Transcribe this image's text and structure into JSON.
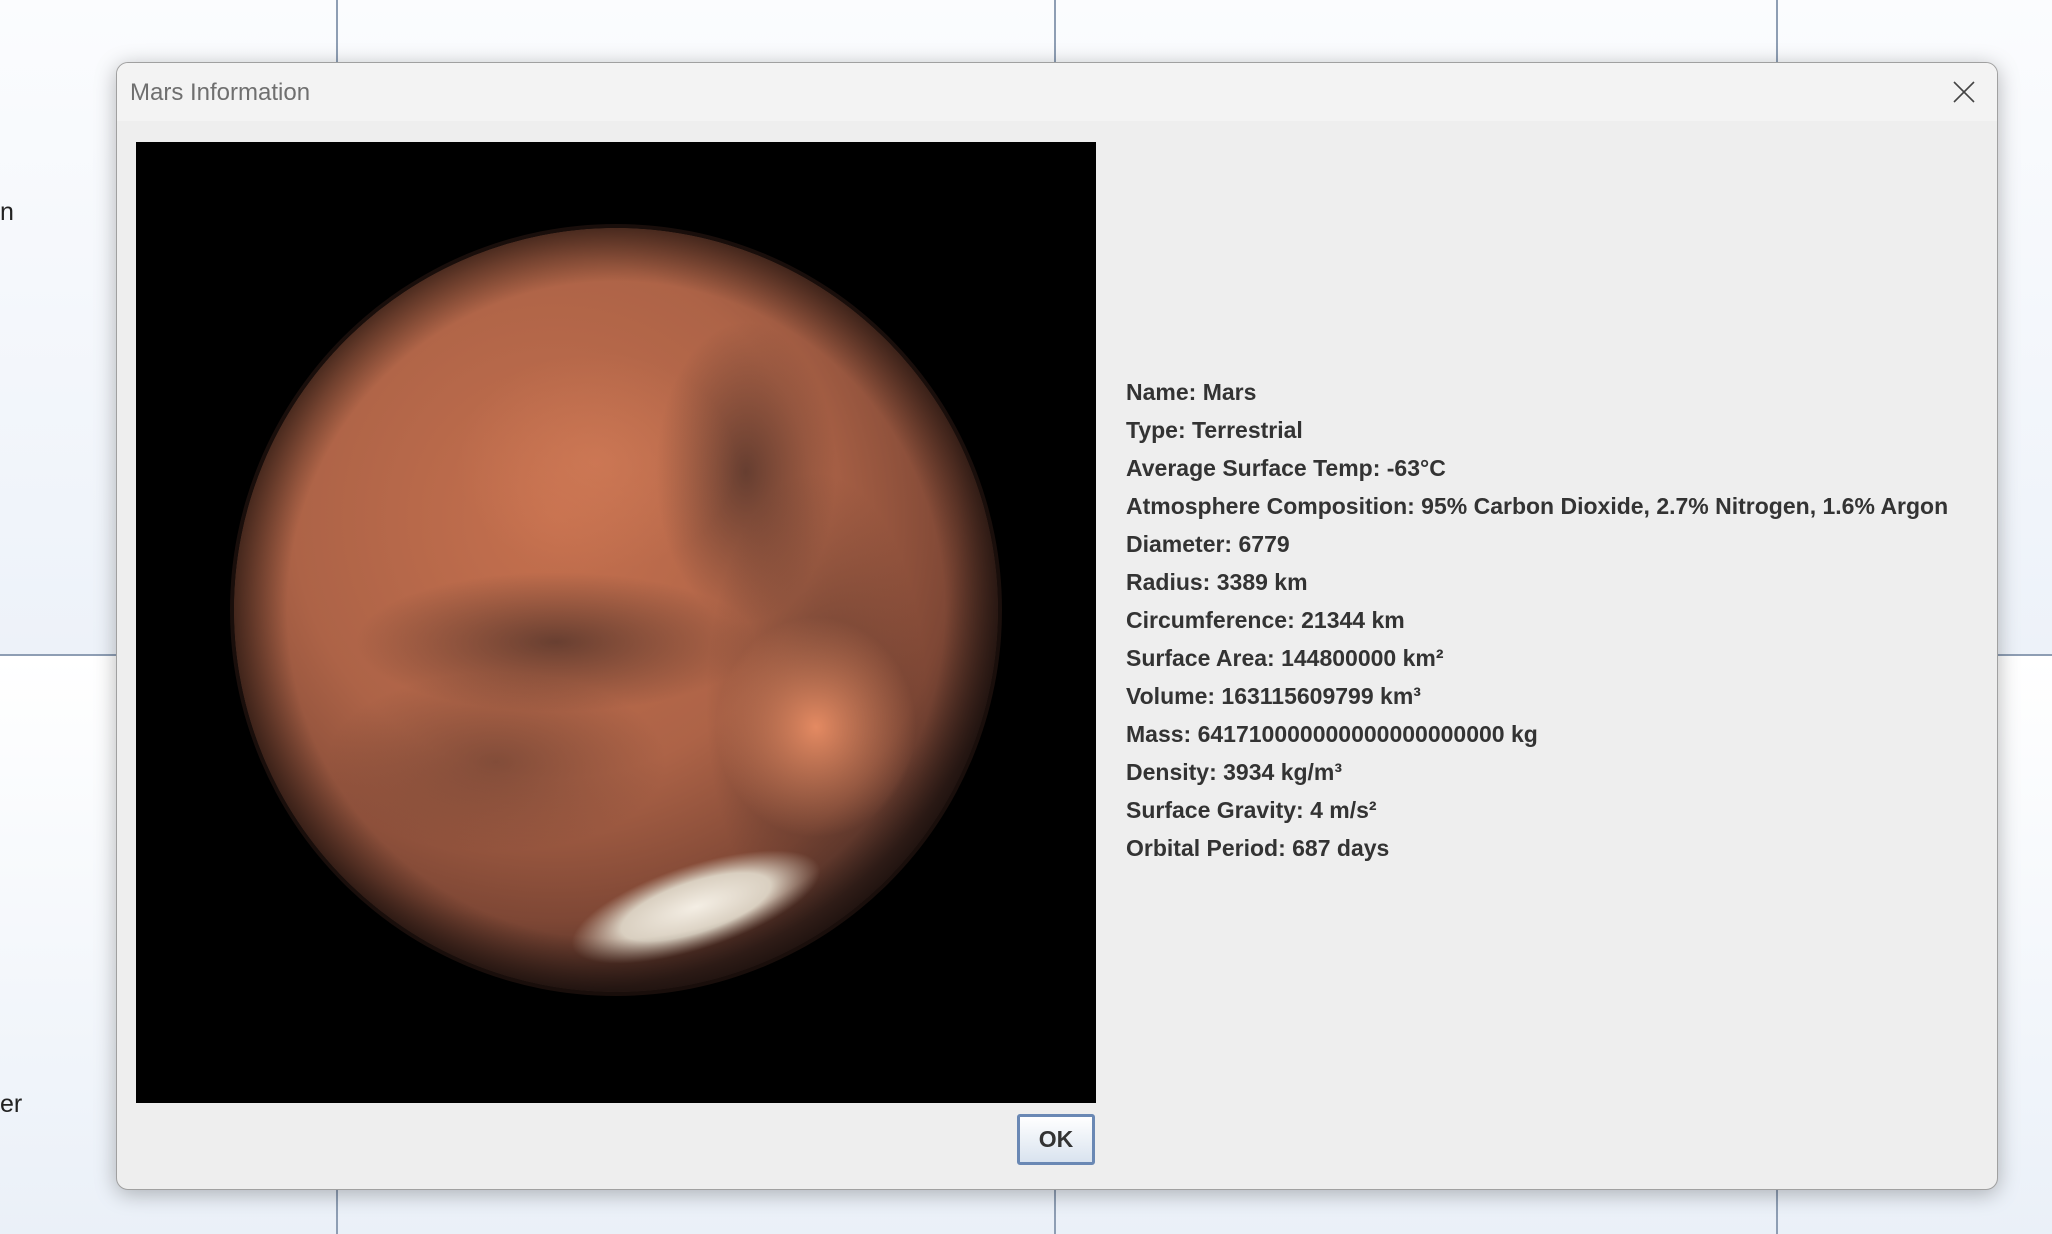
{
  "background": {
    "label_top": "n",
    "label_bottom": "er"
  },
  "dialog": {
    "title": "Mars Information",
    "close_icon": "close-icon",
    "image_description_icon": "mars-planet-photo",
    "info_lines": [
      "Name: Mars",
      "Type: Terrestrial",
      "Average Surface Temp: -63°C",
      "Atmosphere Composition: 95% Carbon Dioxide, 2.7% Nitrogen, 1.6% Argon",
      "Diameter: 6779",
      "Radius: 3389 km",
      "Circumference: 21344 km",
      "Surface Area: 144800000 km²",
      "Volume: 163115609799 km³",
      "Mass: 641710000000000000000000 kg",
      "Density: 3934 kg/m³",
      "Surface Gravity: 4 m/s²",
      "Orbital Period: 687 days"
    ],
    "ok_label": "OK"
  },
  "colors": {
    "dialog_bg": "#eeeeee",
    "text": "#333333",
    "button_border": "#6a88b4"
  }
}
